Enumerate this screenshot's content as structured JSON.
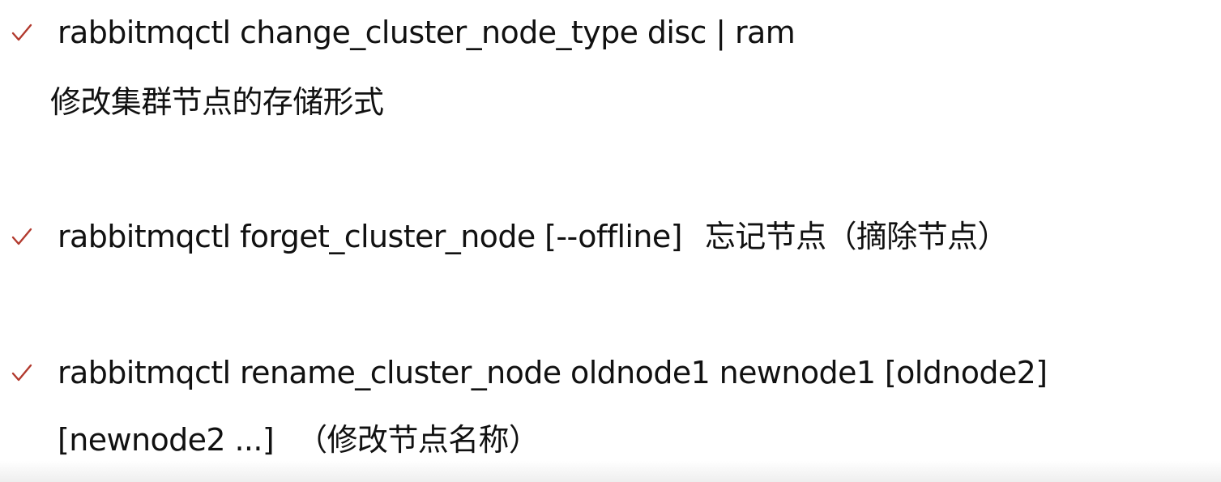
{
  "colors": {
    "check": "#b23a2e",
    "text": "#111111",
    "background": "#ffffff"
  },
  "items": [
    {
      "icon": "checkmark-icon",
      "command": "rabbitmqctl change_cluster_node_type disc | ram",
      "description": "修改集群节点的存储形式"
    },
    {
      "icon": "checkmark-icon",
      "command": "rabbitmqctl forget_cluster_node [--offline]",
      "note": "忘记节点（摘除节点）"
    },
    {
      "icon": "checkmark-icon",
      "command": "rabbitmqctl rename_cluster_node oldnode1 newnode1 [oldnode2]",
      "continuation": "[newnode2 ...]",
      "note": "（修改节点名称）"
    }
  ]
}
